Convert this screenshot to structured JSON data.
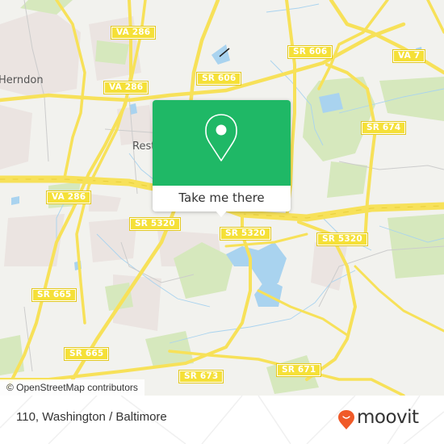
{
  "map": {
    "place_labels": [
      {
        "id": "herndon",
        "text": "Herndon"
      },
      {
        "id": "reston",
        "text": "Rest"
      }
    ],
    "road_shields": [
      {
        "id": "va286-top",
        "text": "VA 286"
      },
      {
        "id": "va286-mid",
        "text": "VA 286"
      },
      {
        "id": "va286-left",
        "text": "VA 286"
      },
      {
        "id": "sr606-a",
        "text": "SR 606"
      },
      {
        "id": "sr606-b",
        "text": "SR 606"
      },
      {
        "id": "va7",
        "text": "VA 7"
      },
      {
        "id": "sr674",
        "text": "SR 674"
      },
      {
        "id": "sr5320-a",
        "text": "SR 5320"
      },
      {
        "id": "sr5320-b",
        "text": "SR 5320"
      },
      {
        "id": "sr5320-c",
        "text": "SR 5320"
      },
      {
        "id": "sr665-a",
        "text": "SR 665"
      },
      {
        "id": "sr665-b",
        "text": "SR 665"
      },
      {
        "id": "sr673",
        "text": "SR 673"
      },
      {
        "id": "sr671",
        "text": "SR 671"
      }
    ],
    "attribution": "© OpenStreetMap contributors",
    "colors": {
      "land": "#f2f2ee",
      "road": "#f7e159",
      "water": "#a9d3ef",
      "park": "#d6e8bd",
      "urban": "#ebe4e1"
    }
  },
  "popup": {
    "icon": "map-pin-icon",
    "button_label": "Take me there",
    "color": "#1fb866"
  },
  "footer": {
    "location_title": "110, Washington / Baltimore",
    "brand_name": "moovit",
    "brand_color": "#f05a28"
  }
}
